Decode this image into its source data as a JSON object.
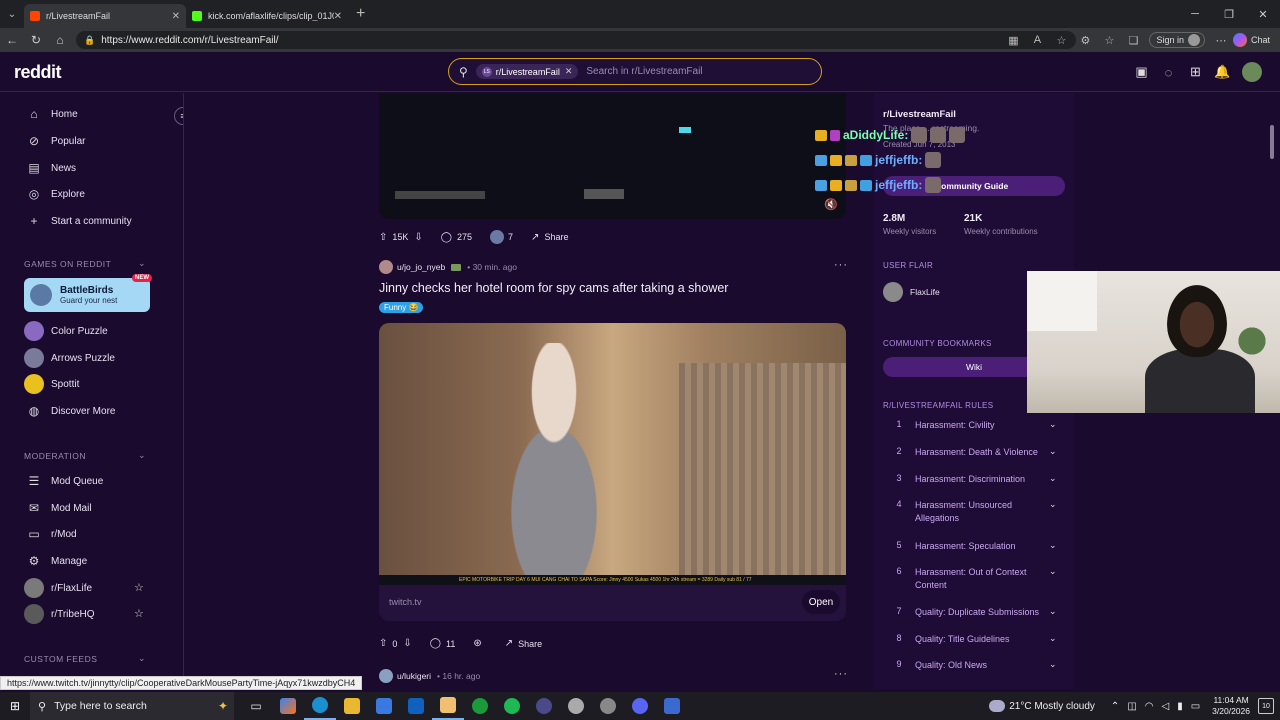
{
  "browser": {
    "tabs": [
      {
        "title": "r/LivestreamFail",
        "active": true,
        "favicon_color": "#ff4500"
      },
      {
        "title": "kick.com/aflaxlife/clips/clip_01J0...",
        "active": false,
        "favicon_color": "#53fc18"
      }
    ],
    "url": "https://www.reddit.com/r/LivestreamFail/",
    "sign_in_label": "Sign in",
    "chat_label": "Chat"
  },
  "header": {
    "logo": "reddit",
    "search_chip": "r/LivestreamFail",
    "search_placeholder": "Search in r/LivestreamFail",
    "accent": "#d4a017"
  },
  "sidebar": {
    "nav": [
      {
        "label": "Home",
        "icon": "home-icon"
      },
      {
        "label": "Popular",
        "icon": "popular-icon"
      },
      {
        "label": "News",
        "icon": "news-icon"
      },
      {
        "label": "Explore",
        "icon": "explore-icon"
      },
      {
        "label": "Start a community",
        "icon": "plus-icon"
      }
    ],
    "games_heading": "GAMES ON REDDIT",
    "promo": {
      "title": "BattleBirds",
      "subtitle": "Guard your nest",
      "badge": "NEW"
    },
    "games": [
      "Color Puzzle",
      "Arrows Puzzle",
      "Spottit",
      "Discover More"
    ],
    "moderation_heading": "MODERATION",
    "moderation": [
      "Mod Queue",
      "Mod Mail",
      "r/Mod",
      "Manage",
      "r/FlaxLife",
      "r/TribeHQ"
    ],
    "custom_feeds_heading": "CUSTOM FEEDS"
  },
  "feed": {
    "post1": {
      "upvotes": "15K",
      "comments": "275",
      "awards": "7",
      "share": "Share"
    },
    "post2": {
      "user": "u/jo_jo_nyeb",
      "time": "30 min. ago",
      "title": "Jinny checks her hotel room for spy cams after taking a shower",
      "flair": "Funny",
      "hud": "EPIC MOTORBIKE TRIP DAY 6 MUI CANG CHAI TO SAPA   Score: Jinny 4500 Sukas 4500   1hr 24h stream = 3289  Daily sub 81 / 77",
      "link": "twitch.tv",
      "open_label": "Open",
      "upvotes": "0",
      "comments": "11",
      "share": "Share"
    },
    "post3": {
      "user": "u/lukigeri",
      "time": "16 hr. ago"
    }
  },
  "chat_overlay": [
    {
      "name": "aDiddyLife:",
      "color": "#7dffb0"
    },
    {
      "name": "jeffjeffb:",
      "color": "#6ab0ff"
    },
    {
      "name": "jeffjeffb:",
      "color": "#6ab0ff"
    }
  ],
  "right_sidebar": {
    "name": "r/LivestreamFail",
    "desc": "The place ... restreaming.",
    "created": "Created Jun 7, 2013",
    "guide": "Community Guide",
    "stats": [
      {
        "value": "2.8M",
        "label": "Weekly visitors"
      },
      {
        "value": "21K",
        "label": "Weekly contributions"
      }
    ],
    "user_flair_heading": "USER FLAIR",
    "user_flair": "FlaxLife",
    "bookmarks_heading": "COMMUNITY BOOKMARKS",
    "wiki": "Wiki",
    "rules_heading": "R/LIVESTREAMFAIL RULES",
    "rules": [
      {
        "num": "1",
        "text": "Harassment: Civility"
      },
      {
        "num": "2",
        "text": "Harassment: Death & Violence"
      },
      {
        "num": "3",
        "text": "Harassment: Discrimination"
      },
      {
        "num": "4",
        "text": "Harassment: Unsourced Allegations"
      },
      {
        "num": "5",
        "text": "Harassment: Speculation"
      },
      {
        "num": "6",
        "text": "Harassment: Out of Context Content"
      },
      {
        "num": "7",
        "text": "Quality: Duplicate Submissions"
      },
      {
        "num": "8",
        "text": "Quality: Title Guidelines"
      },
      {
        "num": "9",
        "text": "Quality: Old News"
      }
    ]
  },
  "status_url": "https://www.twitch.tv/jinnytty/clip/CooperativeDarkMousePartyTime-jAqyx71kwzdbyCH4",
  "taskbar": {
    "search_placeholder": "Type here to search",
    "weather": "21°C  Mostly cloudy",
    "time": "11:04 AM",
    "date": "3/20/2026",
    "notif_count": "10"
  }
}
